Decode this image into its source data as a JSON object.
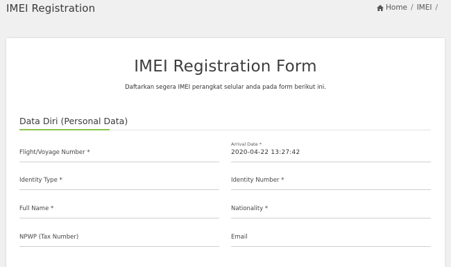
{
  "header": {
    "title": "IMEI Registration",
    "breadcrumb": {
      "home": "Home",
      "current": "IMEI"
    }
  },
  "form": {
    "title": "IMEI Registration Form",
    "subtitle": "Daftarkan segera IMEI perangkat selular anda pada form berikut ini.",
    "section_title": "Data Diri (Personal Data)",
    "fields": {
      "flight": {
        "placeholder": "Flight/Voyage Number *"
      },
      "arrival": {
        "label": "Arrival Date *",
        "value": "2020-04-22 13:27:42"
      },
      "identity_type": {
        "placeholder": "Identity Type *"
      },
      "identity_number": {
        "placeholder": "Identity Number *"
      },
      "full_name": {
        "placeholder": "Full Name *"
      },
      "nationality": {
        "placeholder": "Nationality *"
      },
      "npwp": {
        "placeholder": "NPWP (Tax Number)"
      },
      "email": {
        "placeholder": "Email"
      }
    }
  },
  "colors": {
    "accent": "#8bc34a",
    "background": "#f0f0f0"
  }
}
